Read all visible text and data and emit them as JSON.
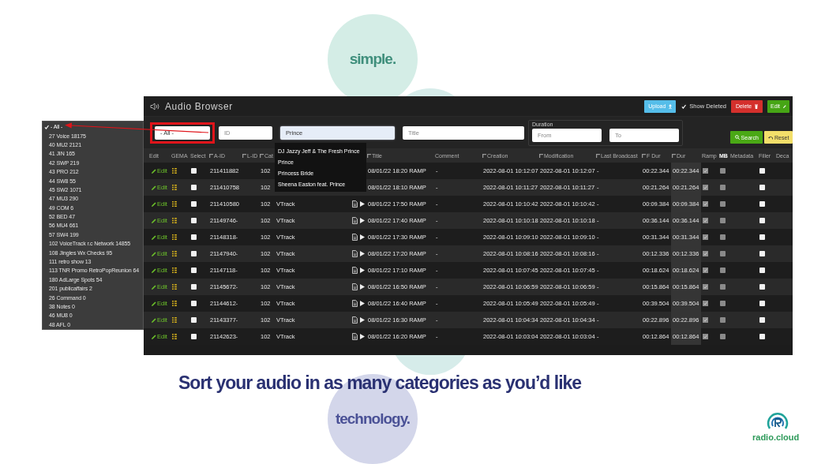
{
  "slide": {
    "circle_labels": [
      "simple.",
      "technology."
    ],
    "caption": "Sort your audio in as many categories as you’d like",
    "logo": "radio.cloud"
  },
  "category_list": {
    "items": [
      {
        "label": "- All -",
        "selected": true
      },
      {
        "label": "27 Voice 18175",
        "selected": false
      },
      {
        "label": "40 MU2 2121",
        "selected": false
      },
      {
        "label": "41 JIN 165",
        "selected": false
      },
      {
        "label": "42 SWP 219",
        "selected": false
      },
      {
        "label": "43 PRO 212",
        "selected": false
      },
      {
        "label": "44 SW8 55",
        "selected": false
      },
      {
        "label": "45 SW2 1071",
        "selected": false
      },
      {
        "label": "47 MU3 290",
        "selected": false
      },
      {
        "label": "49 COM 6",
        "selected": false
      },
      {
        "label": "52 BED 47",
        "selected": false
      },
      {
        "label": "56 MU4 661",
        "selected": false
      },
      {
        "label": "57 SW4 199",
        "selected": false
      },
      {
        "label": "102 VoiceTrack r.c Network 14855",
        "selected": false
      },
      {
        "label": "108 Jingles Wx Checks 95",
        "selected": false
      },
      {
        "label": "111 retro show 13",
        "selected": false
      },
      {
        "label": "113 TNR Promo RetroPopReunion 64",
        "selected": false
      },
      {
        "label": "180 AdLarge Spots 54",
        "selected": false
      },
      {
        "label": "201 publicaffairs 2",
        "selected": false
      },
      {
        "label": "26 Command 0",
        "selected": false
      },
      {
        "label": "38 Notes 0",
        "selected": false
      },
      {
        "label": "46 MU8 0",
        "selected": false
      },
      {
        "label": "48 AFL 0",
        "selected": false
      }
    ]
  },
  "window": {
    "title": "Audio Browser"
  },
  "toolbar": [
    {
      "kind": "upload",
      "label": "Upload"
    },
    {
      "kind": "toggle",
      "label": "Show Deleted",
      "checked": true
    },
    {
      "kind": "delete",
      "label": "Delete"
    },
    {
      "kind": "edit",
      "label": "Edit"
    }
  ],
  "filters": {
    "category": {
      "value": "- All -",
      "highlighted": true
    },
    "id": {
      "placeholder": "ID"
    },
    "artist": {
      "value": "Prince",
      "focused": true
    },
    "title": {
      "placeholder": "Title"
    },
    "duration": {
      "label": "Duration",
      "from": {
        "placeholder": "From"
      },
      "to": {
        "placeholder": "To"
      }
    },
    "actions": [
      {
        "kind": "search",
        "label": "Search"
      },
      {
        "kind": "reset",
        "label": "Reset"
      }
    ]
  },
  "suggestions": [
    "DJ Jazzy Jeff & The Fresh Prince",
    "Prince",
    "Princess Bride",
    "Sheena Easton feat. Prince"
  ],
  "table": {
    "columns": [
      {
        "label": "Edit",
        "sortable": false
      },
      {
        "label": "GEMA",
        "sortable": false
      },
      {
        "label": "Select",
        "sortable": false
      },
      {
        "label": "A-ID",
        "sortable": true
      },
      {
        "label": "L-ID",
        "sortable": true
      },
      {
        "label": "Cat",
        "sortable": true
      },
      {
        "label": "Title",
        "sortable": true
      },
      {
        "label": "Comment",
        "sortable": false
      },
      {
        "label": "Creation",
        "sortable": true
      },
      {
        "label": "Modification",
        "sortable": true
      },
      {
        "label": "Last Broadcast",
        "sortable": true
      },
      {
        "label": "F Dur",
        "sortable": true
      },
      {
        "label": "Dur",
        "sortable": true
      },
      {
        "label": "Ramp",
        "sortable": false
      },
      {
        "label": "MB",
        "sortable": false
      },
      {
        "label": "Metadata",
        "sortable": false
      },
      {
        "label": "Filler",
        "sortable": false
      },
      {
        "label": "Deca",
        "sortable": false
      }
    ],
    "rows": [
      {
        "edit": "Edit",
        "selected": false,
        "a_id": "211411882",
        "cat": "102",
        "media_icons": false,
        "title": "08/01/22 18:20 RAMP",
        "comment": "-",
        "creation": "2022-08-01 10:12:07",
        "modification": "2022-08-01 10:12:07",
        "last_broadcast": "-",
        "f_dur": "00:22.344",
        "dur": "00:22.344",
        "ramp": true,
        "mb": false,
        "filler": false
      },
      {
        "edit": "Edit",
        "selected": false,
        "a_id": "211410758",
        "cat": "102",
        "media_icons": false,
        "title": "08/01/22 18:10 RAMP",
        "comment": "-",
        "creation": "2022-08-01 10:11:27",
        "modification": "2022-08-01 10:11:27",
        "last_broadcast": "-",
        "f_dur": "00:21.264",
        "dur": "00:21.264",
        "ramp": true,
        "mb": false,
        "filler": false
      },
      {
        "edit": "Edit",
        "selected": false,
        "a_id": "211410580",
        "cat": "102",
        "name": "VTrack",
        "media_icons": true,
        "title": "08/01/22 17:50 RAMP",
        "comment": "-",
        "creation": "2022-08-01 10:10:42",
        "modification": "2022-08-01 10:10:42",
        "last_broadcast": "-",
        "f_dur": "00:09.384",
        "dur": "00:09.384",
        "ramp": true,
        "mb": false,
        "filler": false
      },
      {
        "edit": "Edit",
        "selected": false,
        "a_id": "21149746-",
        "cat": "102",
        "name": "VTrack",
        "media_icons": true,
        "title": "08/01/22 17:40 RAMP",
        "comment": "-",
        "creation": "2022-08-01 10:10:18",
        "modification": "2022-08-01 10:10:18",
        "last_broadcast": "-",
        "f_dur": "00:36.144",
        "dur": "00:36.144",
        "ramp": true,
        "mb": false,
        "filler": false
      },
      {
        "edit": "Edit",
        "selected": false,
        "a_id": "21148318-",
        "cat": "102",
        "name": "VTrack",
        "media_icons": true,
        "title": "08/01/22 17:30 RAMP",
        "comment": "-",
        "creation": "2022-08-01 10:09:10",
        "modification": "2022-08-01 10:09:10",
        "last_broadcast": "-",
        "f_dur": "00:31.344",
        "dur": "00:31.344",
        "ramp": true,
        "mb": false,
        "filler": false
      },
      {
        "edit": "Edit",
        "selected": false,
        "a_id": "21147940-",
        "cat": "102",
        "name": "VTrack",
        "media_icons": true,
        "title": "08/01/22 17:20 RAMP",
        "comment": "-",
        "creation": "2022-08-01 10:08:16",
        "modification": "2022-08-01 10:08:16",
        "last_broadcast": "-",
        "f_dur": "00:12.336",
        "dur": "00:12.336",
        "ramp": true,
        "mb": false,
        "filler": false
      },
      {
        "edit": "Edit",
        "selected": false,
        "a_id": "21147118-",
        "cat": "102",
        "name": "VTrack",
        "media_icons": true,
        "title": "08/01/22 17:10 RAMP",
        "comment": "-",
        "creation": "2022-08-01 10:07:45",
        "modification": "2022-08-01 10:07:45",
        "last_broadcast": "-",
        "f_dur": "00:18.624",
        "dur": "00:18.624",
        "ramp": true,
        "mb": false,
        "filler": false
      },
      {
        "edit": "Edit",
        "selected": false,
        "a_id": "21145672-",
        "cat": "102",
        "name": "VTrack",
        "media_icons": true,
        "title": "08/01/22 16:50 RAMP",
        "comment": "-",
        "creation": "2022-08-01 10:06:59",
        "modification": "2022-08-01 10:06:59",
        "last_broadcast": "-",
        "f_dur": "00:15.864",
        "dur": "00:15.864",
        "ramp": true,
        "mb": false,
        "filler": false
      },
      {
        "edit": "Edit",
        "selected": false,
        "a_id": "21144612-",
        "cat": "102",
        "name": "VTrack",
        "media_icons": true,
        "title": "08/01/22 16:40 RAMP",
        "comment": "-",
        "creation": "2022-08-01 10:05:49",
        "modification": "2022-08-01 10:05:49",
        "last_broadcast": "-",
        "f_dur": "00:39.504",
        "dur": "00:39.504",
        "ramp": true,
        "mb": false,
        "filler": false
      },
      {
        "edit": "Edit",
        "selected": false,
        "a_id": "21143377-",
        "cat": "102",
        "name": "VTrack",
        "media_icons": true,
        "title": "08/01/22 16:30 RAMP",
        "comment": "-",
        "creation": "2022-08-01 10:04:34",
        "modification": "2022-08-01 10:04:34",
        "last_broadcast": "-",
        "f_dur": "00:22.896",
        "dur": "00:22.896",
        "ramp": true,
        "mb": false,
        "filler": false
      },
      {
        "edit": "Edit",
        "selected": false,
        "a_id": "21142623-",
        "cat": "102",
        "name": "VTrack",
        "media_icons": true,
        "title": "08/01/22 16:20 RAMP",
        "comment": "-",
        "creation": "2022-08-01 10:03:04",
        "modification": "2022-08-01 10:03:04",
        "last_broadcast": "-",
        "f_dur": "00:12.864",
        "dur": "00:12.864",
        "ramp": true,
        "mb": false,
        "filler": false
      }
    ]
  }
}
